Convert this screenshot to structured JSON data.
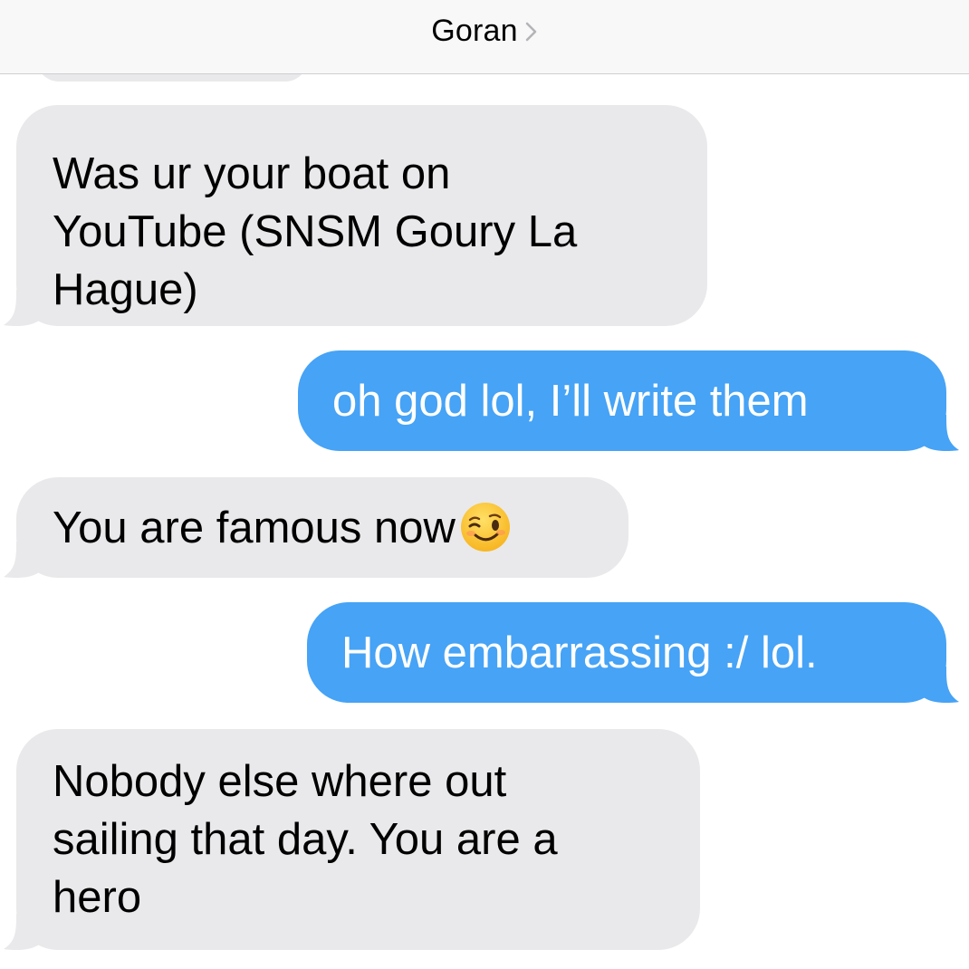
{
  "header": {
    "contact_name": "Goran"
  },
  "colors": {
    "received_bubble": "#e9e9eb",
    "sent_bubble": "#46a3f6",
    "header_bg": "#f8f8f8",
    "chevron": "#b4b4b8"
  },
  "messages": [
    {
      "direction": "received",
      "lines": [
        "Was ur your boat on",
        "YouTube (SNSM Goury La",
        "Hague)"
      ]
    },
    {
      "direction": "sent",
      "lines": [
        "oh god lol, I’ll write them"
      ]
    },
    {
      "direction": "received",
      "lines": [
        "You are famous now"
      ],
      "emoji": "winking-face-emoji"
    },
    {
      "direction": "sent",
      "lines": [
        "How embarrassing :/ lol."
      ]
    },
    {
      "direction": "received",
      "lines": [
        "Nobody else where out",
        "sailing that day. You are a",
        "hero"
      ]
    }
  ]
}
